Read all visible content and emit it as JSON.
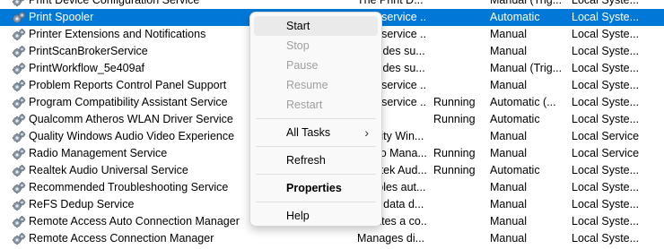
{
  "services": [
    {
      "name": "Print Device Configuration Service",
      "description": "The Print D...",
      "status": "",
      "startup": "Manual (Trig...",
      "logon": "Local Syste..."
    },
    {
      "name": "Print Spooler",
      "description": "This service ...",
      "status": "",
      "startup": "Automatic",
      "logon": "Local Syste...",
      "selected": true
    },
    {
      "name": "Printer Extensions and Notifications",
      "description": "This service ...",
      "status": "",
      "startup": "Manual",
      "logon": "Local Syste..."
    },
    {
      "name": "PrintScanBrokerService",
      "description": "Provides su...",
      "status": "",
      "startup": "Manual",
      "logon": "Local Syste..."
    },
    {
      "name": "PrintWorkflow_5e409af",
      "description": "Provides su...",
      "status": "",
      "startup": "Manual (Trig...",
      "logon": "Local Syste..."
    },
    {
      "name": "Problem Reports Control Panel Support",
      "description": "This service ...",
      "status": "",
      "startup": "Manual",
      "logon": "Local Syste..."
    },
    {
      "name": "Program Compatibility Assistant Service",
      "description": "This service ...",
      "status": "Running",
      "startup": "Automatic (...",
      "logon": "Local Syste..."
    },
    {
      "name": "Qualcomm Atheros WLAN Driver Service",
      "description": "",
      "status": "Running",
      "startup": "Automatic",
      "logon": "Local Syste..."
    },
    {
      "name": "Quality Windows Audio Video Experience",
      "description": "Quality Win...",
      "status": "",
      "startup": "Manual",
      "logon": "Local Service"
    },
    {
      "name": "Radio Management Service",
      "description": "Radio Mana...",
      "status": "Running",
      "startup": "Manual",
      "logon": "Local Service"
    },
    {
      "name": "Realtek Audio Universal Service",
      "description": "Realtek Aud...",
      "status": "Running",
      "startup": "Automatic",
      "logon": "Local Syste..."
    },
    {
      "name": "Recommended Troubleshooting Service",
      "description": "Enables aut...",
      "status": "",
      "startup": "Manual",
      "logon": "Local Syste..."
    },
    {
      "name": "ReFS Dedup Service",
      "description": "Refs data d...",
      "status": "",
      "startup": "Manual",
      "logon": "Local Syste..."
    },
    {
      "name": "Remote Access Auto Connection Manager",
      "description": "Creates a co...",
      "status": "",
      "startup": "Manual",
      "logon": "Local Syste..."
    },
    {
      "name": "Remote Access Connection Manager",
      "description": "Manages di...",
      "status": "",
      "startup": "Manual",
      "logon": "Local Syste..."
    }
  ],
  "context_menu": {
    "start": "Start",
    "stop": "Stop",
    "pause": "Pause",
    "resume": "Resume",
    "restart": "Restart",
    "all_tasks": "All Tasks",
    "refresh": "Refresh",
    "properties": "Properties",
    "help": "Help"
  },
  "colors": {
    "selection": "#0078d7",
    "menu_background": "#f9f9f9",
    "disabled_text": "#a0a0a0"
  },
  "icons": {
    "service": "gear-icon",
    "submenu": "chevron-right-icon"
  }
}
